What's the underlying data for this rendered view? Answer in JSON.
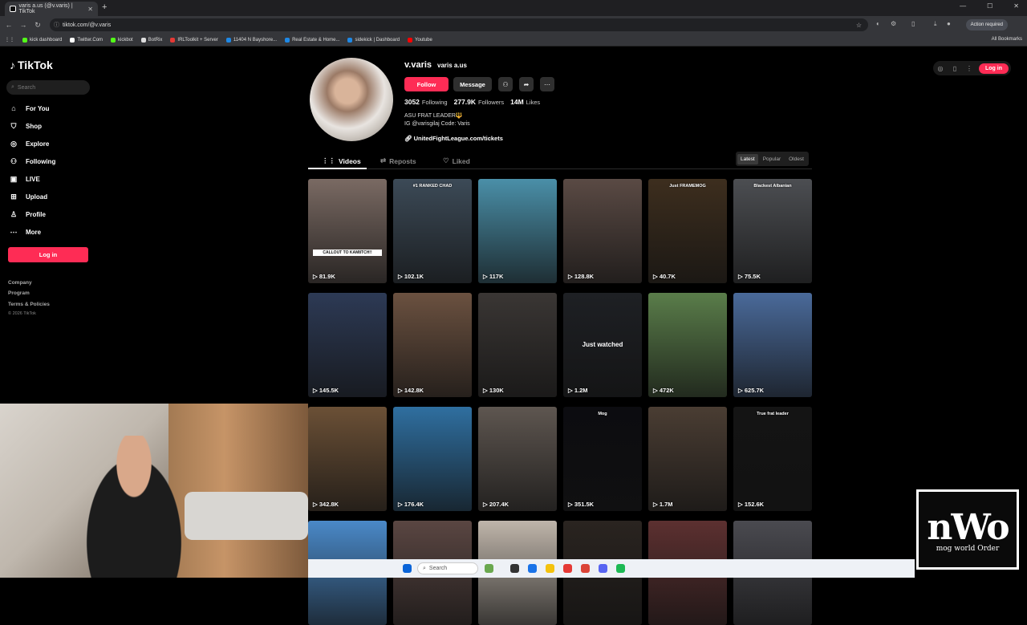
{
  "browser": {
    "tab_title": "varis a.us (@v.varis) | TikTok",
    "new_tab": "+",
    "url": "tiktok.com/@v.varis",
    "action_required": "Action required",
    "bookmarks": [
      {
        "label": "kick dashboard",
        "color": "#53fc18"
      },
      {
        "label": "Twitter.Com",
        "color": "#ffffff"
      },
      {
        "label": "kickbot",
        "color": "#53fc18"
      },
      {
        "label": "BotRix",
        "color": "#dddddd"
      },
      {
        "label": "IRLToolkit + Server",
        "color": "#e53935"
      },
      {
        "label": "11404 N Bayshore...",
        "color": "#1e88e5"
      },
      {
        "label": "Real Estate & Home...",
        "color": "#1e88e5"
      },
      {
        "label": "sidekick | Dashboard",
        "color": "#1e88e5"
      },
      {
        "label": "Youtube",
        "color": "#ff0000"
      }
    ],
    "all_bookmarks": "All Bookmarks"
  },
  "sidebar": {
    "brand": "TikTok",
    "search_placeholder": "Search",
    "nav": [
      {
        "label": "For You",
        "icon": "home-icon",
        "glyph": "⌂"
      },
      {
        "label": "Shop",
        "icon": "bag-icon",
        "glyph": "⛉"
      },
      {
        "label": "Explore",
        "icon": "compass-icon",
        "glyph": "◎"
      },
      {
        "label": "Following",
        "icon": "person-plus-icon",
        "glyph": "⚇"
      },
      {
        "label": "LIVE",
        "icon": "live-icon",
        "glyph": "▣"
      },
      {
        "label": "Upload",
        "icon": "plus-square-icon",
        "glyph": "⊞"
      },
      {
        "label": "Profile",
        "icon": "person-icon",
        "glyph": "♙"
      },
      {
        "label": "More",
        "icon": "ellipsis-icon",
        "glyph": "⋯"
      }
    ],
    "login": "Log in",
    "footer": [
      "Company",
      "Program",
      "Terms & Policies"
    ],
    "copyright": "© 2026 TikTok"
  },
  "topright": {
    "login": "Log in"
  },
  "profile": {
    "username": "v.varis",
    "nickname": "varis a.us",
    "follow": "Follow",
    "message": "Message",
    "following_count": "3052",
    "following_label": "Following",
    "followers_count": "277.9K",
    "followers_label": "Followers",
    "likes_count": "14M",
    "likes_label": "Likes",
    "bio_line1": "ASU FRAT LEADER🔱",
    "bio_line2": "IG @varisgilaj Code: Varis",
    "link": "UnitedFightLeague.com/tickets",
    "tabs": [
      "Videos",
      "Reposts",
      "Liked"
    ],
    "sort": [
      "Latest",
      "Popular",
      "Oldest"
    ]
  },
  "videos": [
    {
      "views": "81.9K",
      "tag": "CALLOUT TO KAM8TCH!!",
      "caption": "",
      "color": "#7a6a63"
    },
    {
      "views": "102.1K",
      "caption": "#1 RANKED CHAD",
      "color": "#3c4a57"
    },
    {
      "views": "117K",
      "caption": "",
      "color": "#4a8fa8"
    },
    {
      "views": "128.8K",
      "caption": "",
      "color": "#5a4a44"
    },
    {
      "views": "40.7K",
      "caption": "Just FRAMEMOG",
      "color": "#3d2e1e"
    },
    {
      "views": "75.5K",
      "caption": "Blackest Albanian",
      "color": "#4c4e52"
    },
    {
      "views": "145.5K",
      "caption": "",
      "color": "#2d3a55"
    },
    {
      "views": "142.8K",
      "caption": "",
      "color": "#6b5140"
    },
    {
      "views": "130K",
      "caption": "",
      "color": "#3a3634"
    },
    {
      "views": "1.2M",
      "caption": "",
      "midcaption": "Just watched",
      "color": "#1e2024"
    },
    {
      "views": "472K",
      "caption": "",
      "color": "#5a7d4a"
    },
    {
      "views": "625.7K",
      "caption": "",
      "color": "#4a6a9a"
    },
    {
      "views": "342.8K",
      "caption": "",
      "color": "#6b5036"
    },
    {
      "views": "176.4K",
      "caption": "",
      "color": "#2f6fa0"
    },
    {
      "views": "207.4K",
      "caption": "",
      "color": "#5e5650"
    },
    {
      "views": "351.5K",
      "caption": "Mog",
      "color": "#0c0c10"
    },
    {
      "views": "1.7M",
      "caption": "",
      "color": "#4a3d33"
    },
    {
      "views": "152.6K",
      "caption": "True frat leader",
      "color": "#141414"
    },
    {
      "views": "",
      "caption": "",
      "color": "#4a89c8"
    },
    {
      "views": "",
      "caption": "",
      "color": "#5a4642"
    },
    {
      "views": "",
      "caption": "",
      "color": "#bfb5aa"
    },
    {
      "views": "",
      "caption": "",
      "color": "#2a2420"
    },
    {
      "views": "",
      "caption": "",
      "color": "#5c3030"
    },
    {
      "views": "",
      "caption": "",
      "color": "#4a4a50"
    }
  ],
  "overlay": {
    "logo_big": "nWo",
    "logo_small": "mog world Order"
  },
  "taskbar": {
    "search": "Search"
  }
}
